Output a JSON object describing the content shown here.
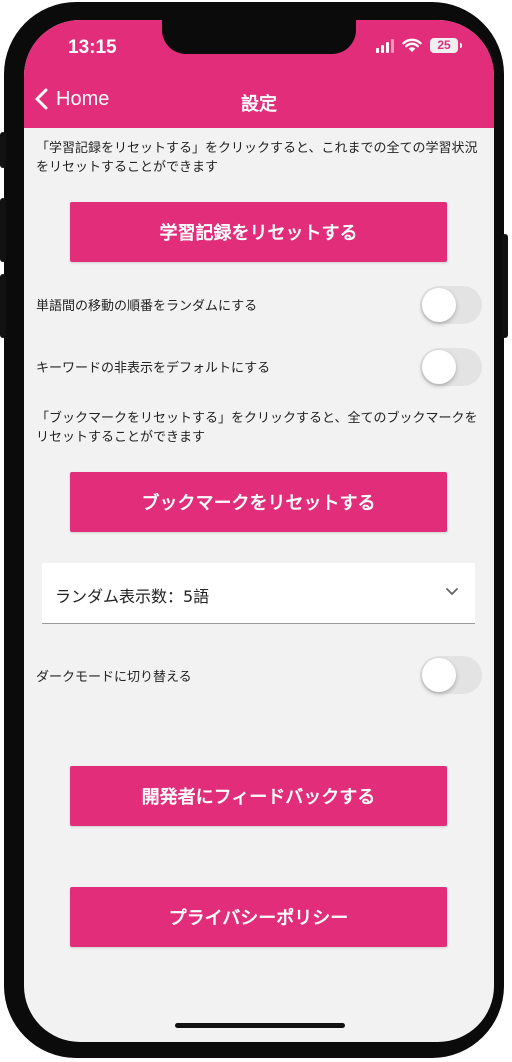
{
  "status_bar": {
    "time": "13:15",
    "battery": "25"
  },
  "header": {
    "back_label": "Home",
    "title": "設定"
  },
  "sections": {
    "reset_history": {
      "description": "「学習記録をリセットする」をクリックすると、これまでの全ての学習状況をリセットすることができます",
      "button_label": "学習記録をリセットする"
    },
    "random_order": {
      "label": "単語間の移動の順番をランダムにする",
      "enabled": false
    },
    "hide_keywords": {
      "label": "キーワードの非表示をデフォルトにする",
      "enabled": false
    },
    "reset_bookmarks": {
      "description": "「ブックマークをリセットする」をクリックすると、全てのブックマークをリセットすることができます",
      "button_label": "ブックマークをリセットする"
    },
    "random_count_select": {
      "selected": "ランダム表示数：5語"
    },
    "dark_mode": {
      "label": "ダークモードに切り替える",
      "enabled": false
    },
    "feedback": {
      "button_label": "開発者にフィードバックする"
    },
    "privacy": {
      "button_label": "プライバシーポリシー"
    }
  },
  "colors": {
    "accent": "#e22d7b",
    "background": "#f2f2f2",
    "toggle_off": "#e3e3e3"
  },
  "icons": {
    "back": "chevron-left-icon",
    "select": "chevron-down-icon",
    "wifi": "wifi-icon",
    "signal": "signal-icon",
    "battery": "battery-icon"
  }
}
